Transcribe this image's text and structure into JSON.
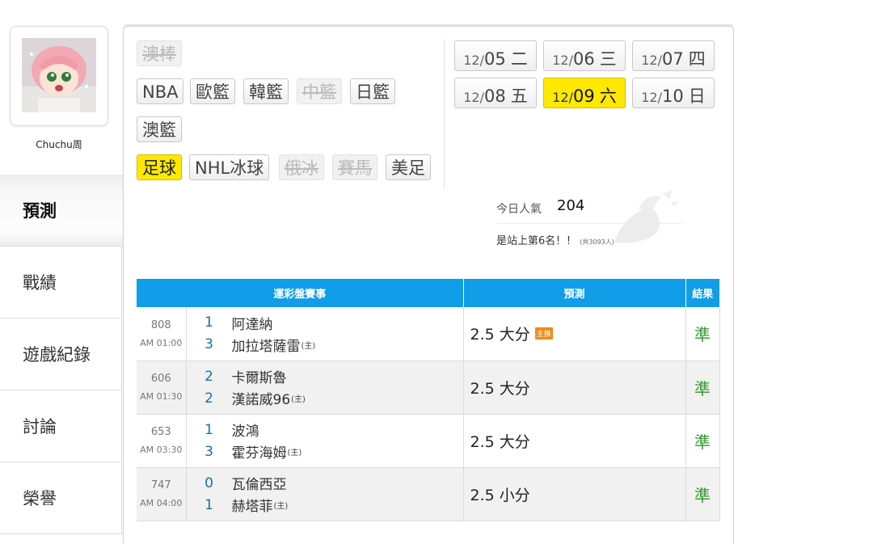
{
  "user": {
    "name": "Chuchu周"
  },
  "menu": [
    {
      "label": "預測",
      "active": true
    },
    {
      "label": "戰績"
    },
    {
      "label": "遊戲紀錄"
    },
    {
      "label": "討論"
    },
    {
      "label": "榮譽"
    }
  ],
  "categories": {
    "row0": [
      {
        "label": "澳棒",
        "state": "disabled"
      }
    ],
    "row1": [
      {
        "label": "NBA"
      },
      {
        "label": "歐籃"
      },
      {
        "label": "韓籃"
      },
      {
        "label": "中籃",
        "state": "disabled"
      },
      {
        "label": "日籃"
      }
    ],
    "row2": [
      {
        "label": "澳籃"
      }
    ],
    "row3": [
      {
        "label": "足球",
        "state": "active"
      },
      {
        "label": "NHL冰球"
      },
      {
        "label": "俄冰",
        "state": "disabled"
      },
      {
        "label": "賽馬",
        "state": "disabled"
      },
      {
        "label": "美足"
      }
    ]
  },
  "dates": [
    {
      "month": "12/",
      "day": "05",
      "weekday": "二"
    },
    {
      "month": "12/",
      "day": "06",
      "weekday": "三"
    },
    {
      "month": "12/",
      "day": "07",
      "weekday": "四"
    },
    {
      "month": "12/",
      "day": "08",
      "weekday": "五"
    },
    {
      "month": "12/",
      "day": "09",
      "weekday": "六",
      "active": true
    },
    {
      "month": "12/",
      "day": "10",
      "weekday": "日"
    }
  ],
  "stats": {
    "popularity_label": "今日人氣",
    "popularity_value": "204",
    "rank_text": "是站上第6名！！",
    "rank_total": "(共3093人)"
  },
  "table": {
    "headers": {
      "event": "運彩盤賽事",
      "prediction": "預測",
      "result": "結果"
    },
    "home_mark": "(主)",
    "rows": [
      {
        "game_no": "808",
        "time": "AM 01:00",
        "away_score": "1",
        "away_team": "阿達納",
        "home_score": "3",
        "home_team": "加拉塔薩雷",
        "prediction": "2.5 大分",
        "badge": "主推",
        "result": "準"
      },
      {
        "game_no": "606",
        "time": "AM 01:30",
        "away_score": "2",
        "away_team": "卡爾斯魯",
        "home_score": "2",
        "home_team": "漢諾威96",
        "prediction": "2.5 大分",
        "badge": "",
        "result": "準"
      },
      {
        "game_no": "653",
        "time": "AM 03:30",
        "away_score": "1",
        "away_team": "波鴻",
        "home_score": "3",
        "home_team": "霍芬海姆",
        "prediction": "2.5 大分",
        "badge": "",
        "result": "準"
      },
      {
        "game_no": "747",
        "time": "AM 04:00",
        "away_score": "0",
        "away_team": "瓦倫西亞",
        "home_score": "1",
        "home_team": "赫塔菲",
        "prediction": "2.5 小分",
        "badge": "",
        "result": "準"
      }
    ]
  },
  "colors": {
    "accent_yellow": "#ffe800",
    "header_blue": "#119de8",
    "result_green": "#2e9a2e",
    "badge_orange": "#f08a1c"
  }
}
